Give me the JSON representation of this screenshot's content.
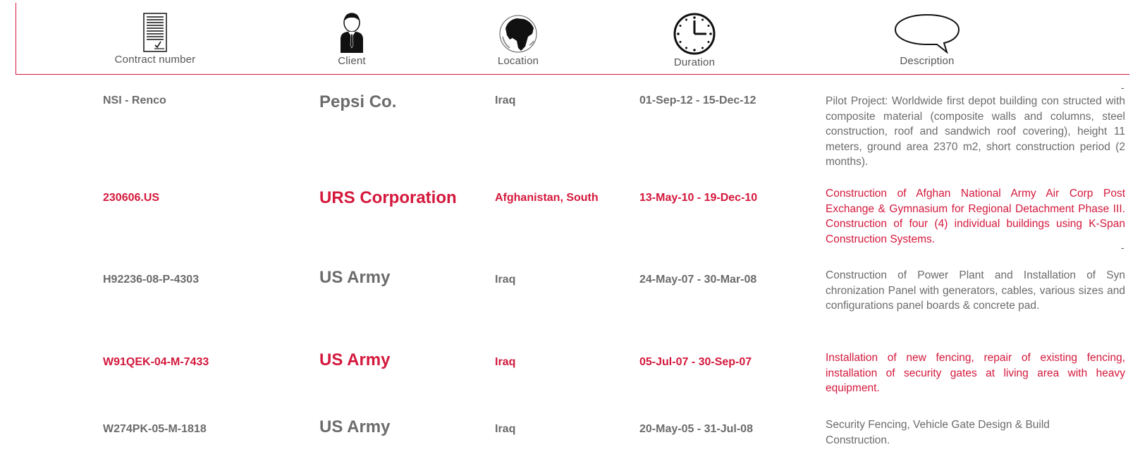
{
  "header": {
    "columns": [
      {
        "label": "Contract number",
        "icon": "document-icon"
      },
      {
        "label": "Client",
        "icon": "person-icon"
      },
      {
        "label": "Location",
        "icon": "globe-icon"
      },
      {
        "label": "Duration",
        "icon": "clock-icon"
      },
      {
        "label": "Description",
        "icon": "speech-bubble-icon"
      }
    ]
  },
  "colors": {
    "accent": "#d4183c",
    "gray": "#6b6b6b"
  },
  "rows": [
    {
      "contract": "NSI - Renco",
      "client": "Pepsi Co.",
      "location": "Iraq",
      "duration": "01-Sep-12 - 15-Dec-12",
      "description": "Pilot Project: Worldwide first depot building con structed with composite material (composite walls and columns, steel construction, roof and sandwich roof covering), height 11 meters, ground area 2370 m2, short construction period (2 months).",
      "style": "gray"
    },
    {
      "contract": "230606.US",
      "client": "URS Corporation",
      "location": "Afghanistan, South",
      "duration": "13-May-10 - 19-Dec-10",
      "description": "Construction of Afghan National Army Air Corp Post Exchange & Gymnasium for Regional Detachment Phase III. Construction of four (4) individual buildings using K-Span Construction Systems.",
      "style": "red"
    },
    {
      "contract": "H92236-08-P-4303",
      "client": "US Army",
      "location": "Iraq",
      "duration": "24-May-07 - 30-Mar-08",
      "description": "Construction of Power Plant and Installation of Syn chronization Panel with generators, cables, various sizes and configurations panel boards & concrete pad.",
      "style": "gray"
    },
    {
      "contract": "W91QEK-04-M-7433",
      "client": "US Army",
      "location": "Iraq",
      "duration": "05-Jul-07 - 30-Sep-07",
      "description": "Installation of new fencing, repair of existing fencing, installation of security gates at living area with heavy equipment.",
      "style": "red"
    },
    {
      "contract": "W274PK-05-M-1818",
      "client": "US Army",
      "location": "Iraq",
      "duration": "20-May-05 - 31-Jul-08",
      "description": "Security Fencing, Vehicle Gate Design & Build Construction.",
      "style": "gray"
    }
  ],
  "marks": {
    "dash": "-"
  }
}
